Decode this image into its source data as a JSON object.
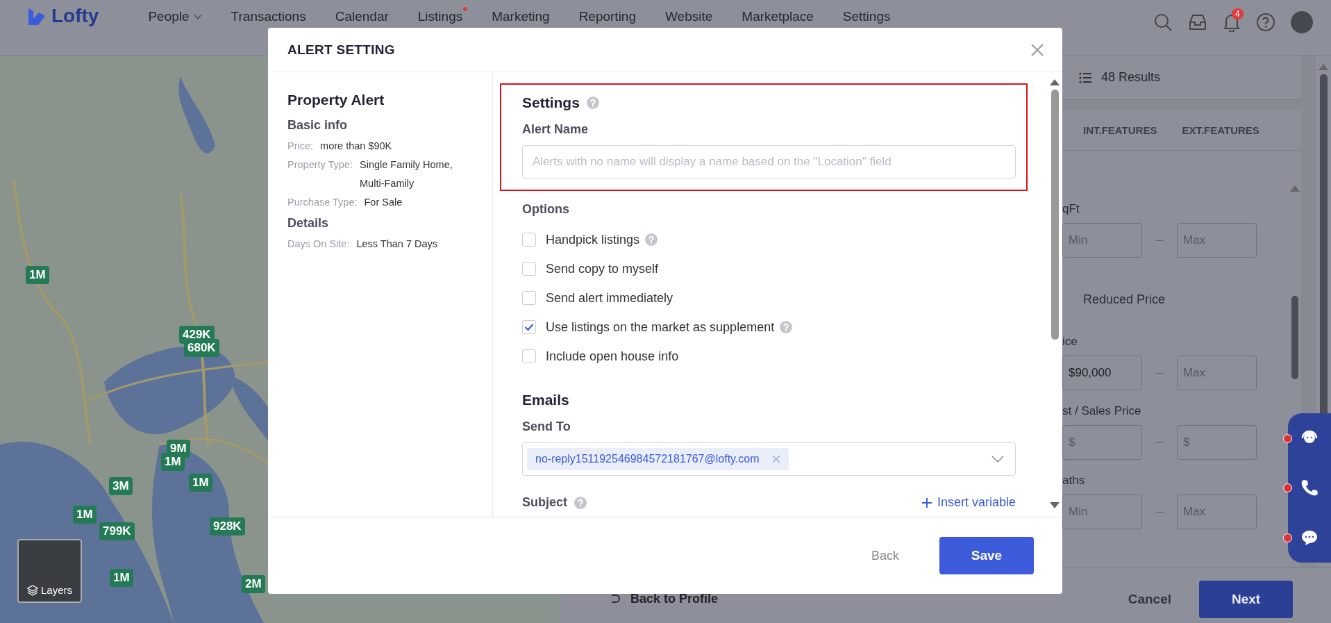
{
  "nav": {
    "logo": "Lofty",
    "items": [
      {
        "label": "People",
        "dropdown": true,
        "dot": false
      },
      {
        "label": "Transactions",
        "dropdown": false,
        "dot": false
      },
      {
        "label": "Calendar",
        "dropdown": false,
        "dot": false
      },
      {
        "label": "Listings",
        "dropdown": false,
        "dot": true
      },
      {
        "label": "Marketing",
        "dropdown": false,
        "dot": false
      },
      {
        "label": "Reporting",
        "dropdown": false,
        "dot": false
      },
      {
        "label": "Website",
        "dropdown": false,
        "dot": false
      },
      {
        "label": "Marketplace",
        "dropdown": false,
        "dot": false
      },
      {
        "label": "Settings",
        "dropdown": false,
        "dot": false
      }
    ],
    "notification_count": "4"
  },
  "map": {
    "markers": [
      {
        "label": "1M"
      },
      {
        "label": "429K"
      },
      {
        "label": "680K"
      },
      {
        "label": "9M"
      },
      {
        "label": "1M"
      },
      {
        "label": "3M"
      },
      {
        "label": "1M"
      },
      {
        "label": "928K"
      },
      {
        "label": "1M"
      },
      {
        "label": "799K"
      },
      {
        "label": "1M"
      },
      {
        "label": "2M"
      }
    ],
    "layers": "Layers"
  },
  "results": {
    "count": "48 Results"
  },
  "filter_tabs": [
    {
      "label": "INT.FEATURES"
    },
    {
      "label": "EXT.FEATURES"
    }
  ],
  "filters": [
    {
      "kind": "range",
      "label": "qFt",
      "min": {
        "placeholder": "Min"
      },
      "max": {
        "placeholder": "Max"
      }
    },
    {
      "kind": "option",
      "label": "Reduced Price"
    },
    {
      "kind": "range",
      "label": "ice",
      "min": {
        "value": "$90,000"
      },
      "max": {
        "placeholder": "Max"
      }
    },
    {
      "kind": "range",
      "label": "st / Sales Price",
      "min": {
        "placeholder": "$"
      },
      "max": {
        "placeholder": "$"
      }
    },
    {
      "kind": "range",
      "label": "aths",
      "min": {
        "placeholder": "Min"
      },
      "max": {
        "placeholder": "Max"
      }
    }
  ],
  "bottom_bar": {
    "back": "Back to Profile",
    "cancel": "Cancel",
    "next": "Next"
  },
  "modal": {
    "title": "ALERT SETTING",
    "summary": {
      "title": "Property Alert",
      "groups": [
        {
          "heading": "Basic info",
          "fields": [
            {
              "label": "Price:",
              "value": "more than $90K"
            },
            {
              "label": "Property Type:",
              "value": "Single Family Home, Multi-Family"
            },
            {
              "label": "Purchase Type:",
              "value": "For Sale"
            }
          ]
        },
        {
          "heading": "Details",
          "fields": [
            {
              "label": "Days On Site:",
              "value": "Less Than 7 Days"
            }
          ]
        }
      ]
    },
    "settings": {
      "heading": "Settings",
      "highlighted": true,
      "alert_name_label": "Alert Name",
      "alert_name": {
        "placeholder": "Alerts with no name will display a name based on the \"Location\" field"
      }
    },
    "options": {
      "heading": "Options",
      "items": [
        {
          "label": "Handpick listings",
          "checked": false,
          "help": true
        },
        {
          "label": "Send copy to myself",
          "checked": false,
          "help": false
        },
        {
          "label": "Send alert immediately",
          "checked": false,
          "help": false
        },
        {
          "label": "Use listings on the market as supplement",
          "checked": true,
          "help": true
        },
        {
          "label": "Include open house info",
          "checked": false,
          "help": false
        }
      ]
    },
    "emails": {
      "heading": "Emails",
      "send_to_label": "Send To",
      "recipients": [
        "no-reply151192546984572181767@lofty.com"
      ],
      "subject_label": "Subject",
      "insert_variable": "Insert variable"
    },
    "back": "Back",
    "save": "Save"
  }
}
